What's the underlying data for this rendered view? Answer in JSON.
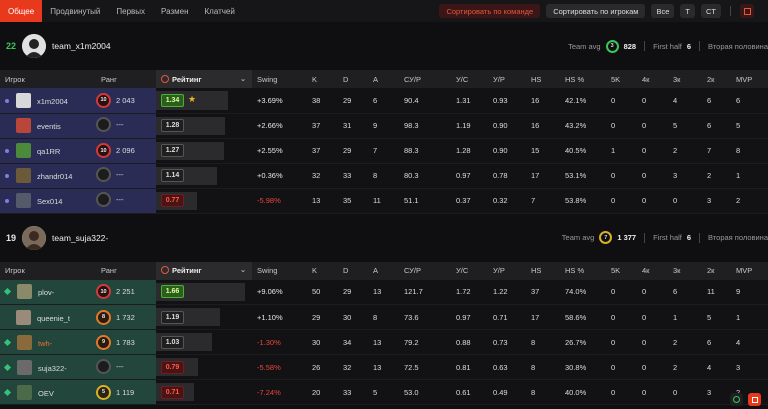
{
  "tabs": [
    "Общее",
    "Продвинутый",
    "Первых",
    "Размен",
    "Клатчей"
  ],
  "toolbar": {
    "sort_team": "Сортировать по команде",
    "sort_players": "Сортировать по игрокам",
    "all": "Все",
    "t": "T",
    "ct": "CT"
  },
  "columns": {
    "player": "Игрок",
    "rank": "Ранг",
    "rating": "Рейтинг",
    "swing": "Swing",
    "k": "K",
    "d": "D",
    "a": "A",
    "adr": "СУ/Р",
    "kpr": "У/С",
    "dpr": "У/Р",
    "hs": "HS",
    "hsp": "HS %",
    "k5": "5K",
    "k4": "4к",
    "k3": "3к",
    "k2": "2к",
    "mvp": "MVP"
  },
  "teams": [
    {
      "score": "22",
      "score_color": "#3bc45a",
      "name": "team_x1m2004",
      "avg_label": "Team avg",
      "avg_rank": "3",
      "avg_rank_color": "#3bc45a",
      "avg_value": "828",
      "half_label": "First half",
      "half_value": "6",
      "half2_label": "Вторая половина",
      "half2_value": "",
      "rating_label": "Рейтинг",
      "players": [
        {
          "name": "x1m2004",
          "marker": "dot",
          "avatar": "#d8d8d8",
          "rank": "10",
          "rank_style": "r",
          "rank_value": "2 043",
          "rating": "1.34",
          "rating_style": "green",
          "rating_fill": 0.75,
          "star": true,
          "swing": "+3.69%",
          "swing_neg": false,
          "k": "38",
          "d": "29",
          "a": "6",
          "adr": "90.4",
          "kpr": "1.31",
          "dpr": "0.93",
          "hs": "16",
          "hsp": "42.1%",
          "k5": "0",
          "k4": "0",
          "k3": "4",
          "k2": "6",
          "mvp": "6"
        },
        {
          "name": "eventis",
          "marker": "none",
          "avatar": "#b8473a",
          "rank": "",
          "rank_style": "g",
          "rank_value": "---",
          "rating": "1.28",
          "rating_style": "grey",
          "rating_fill": 0.72,
          "star": false,
          "swing": "+2.66%",
          "swing_neg": false,
          "k": "37",
          "d": "31",
          "a": "9",
          "adr": "98.3",
          "kpr": "1.19",
          "dpr": "0.90",
          "hs": "16",
          "hsp": "43.2%",
          "k5": "0",
          "k4": "0",
          "k3": "5",
          "k2": "6",
          "mvp": "5"
        },
        {
          "name": "qa1RR",
          "marker": "dot",
          "avatar": "#4a8a3a",
          "rank": "10",
          "rank_style": "r",
          "rank_value": "2 096",
          "rating": "1.27",
          "rating_style": "grey",
          "rating_fill": 0.71,
          "star": false,
          "swing": "+2.55%",
          "swing_neg": false,
          "k": "37",
          "d": "29",
          "a": "7",
          "adr": "88.3",
          "kpr": "1.28",
          "dpr": "0.90",
          "hs": "15",
          "hsp": "40.5%",
          "k5": "1",
          "k4": "0",
          "k3": "2",
          "k2": "7",
          "mvp": "8"
        },
        {
          "name": "zhandr014",
          "marker": "dot",
          "avatar": "#6a5a3a",
          "rank": "",
          "rank_style": "g",
          "rank_value": "---",
          "rating": "1.14",
          "rating_style": "grey",
          "rating_fill": 0.64,
          "star": false,
          "swing": "+0.36%",
          "swing_neg": false,
          "k": "32",
          "d": "33",
          "a": "8",
          "adr": "80.3",
          "kpr": "0.97",
          "dpr": "0.78",
          "hs": "17",
          "hsp": "53.1%",
          "k5": "0",
          "k4": "0",
          "k3": "3",
          "k2": "2",
          "mvp": "1"
        },
        {
          "name": "Sex014",
          "marker": "dot",
          "avatar": "#555a6a",
          "rank": "",
          "rank_style": "g",
          "rank_value": "---",
          "rating": "0.77",
          "rating_style": "red",
          "rating_fill": 0.43,
          "star": false,
          "swing": "-5.98%",
          "swing_neg": true,
          "k": "13",
          "d": "35",
          "a": "11",
          "adr": "51.1",
          "kpr": "0.37",
          "dpr": "0.32",
          "hs": "7",
          "hsp": "53.8%",
          "k5": "0",
          "k4": "0",
          "k3": "0",
          "k2": "3",
          "mvp": "2"
        }
      ]
    },
    {
      "score": "19",
      "score_color": "#e8e8e8",
      "name": "team_suja322-",
      "avg_label": "Team avg",
      "avg_rank": "7",
      "avg_rank_color": "#d9b02a",
      "avg_value": "1 377",
      "half_label": "First half",
      "half_value": "6",
      "half2_label": "Вторая половина",
      "half2_value": "",
      "rating_label": "Рейтинг",
      "players": [
        {
          "name": "plov-",
          "marker": "diamond",
          "avatar": "#8a8a6a",
          "rank": "10",
          "rank_style": "r",
          "rank_value": "2 251",
          "rating": "1.66",
          "rating_style": "green",
          "rating_fill": 0.93,
          "star": false,
          "swing": "+9.06%",
          "swing_neg": false,
          "k": "50",
          "d": "29",
          "a": "13",
          "adr": "121.7",
          "kpr": "1.72",
          "dpr": "1.22",
          "hs": "37",
          "hsp": "74.0%",
          "k5": "0",
          "k4": "0",
          "k3": "6",
          "k2": "11",
          "mvp": "9"
        },
        {
          "name": "queenie_t",
          "marker": "none",
          "avatar": "#9a8a7a",
          "rank": "8",
          "rank_style": "o",
          "rank_value": "1 732",
          "rating": "1.19",
          "rating_style": "grey",
          "rating_fill": 0.67,
          "star": false,
          "swing": "+1.10%",
          "swing_neg": false,
          "k": "29",
          "d": "30",
          "a": "8",
          "adr": "73.6",
          "kpr": "0.97",
          "dpr": "0.71",
          "hs": "17",
          "hsp": "58.6%",
          "k5": "0",
          "k4": "0",
          "k3": "1",
          "k2": "5",
          "mvp": "1"
        },
        {
          "name": "twh-",
          "marker": "diamond",
          "name_color": "#f07030",
          "avatar": "#8a6a3a",
          "rank": "9",
          "rank_style": "o",
          "rank_value": "1 783",
          "rating": "1.03",
          "rating_style": "grey",
          "rating_fill": 0.58,
          "star": false,
          "swing": "-1.30%",
          "swing_neg": true,
          "k": "30",
          "d": "34",
          "a": "13",
          "adr": "79.2",
          "kpr": "0.88",
          "dpr": "0.73",
          "hs": "8",
          "hsp": "26.7%",
          "k5": "0",
          "k4": "0",
          "k3": "2",
          "k2": "6",
          "mvp": "4"
        },
        {
          "name": "suja322-",
          "marker": "diamond",
          "avatar": "#6a6a6a",
          "rank": "",
          "rank_style": "g",
          "rank_value": "---",
          "rating": "0.79",
          "rating_style": "red",
          "rating_fill": 0.44,
          "star": false,
          "swing": "-5.58%",
          "swing_neg": true,
          "k": "26",
          "d": "32",
          "a": "13",
          "adr": "72.5",
          "kpr": "0.81",
          "dpr": "0.63",
          "hs": "8",
          "hsp": "30.8%",
          "k5": "0",
          "k4": "0",
          "k3": "2",
          "k2": "4",
          "mvp": "3"
        },
        {
          "name": "OEV",
          "marker": "diamond",
          "avatar": "#4a6a4a",
          "rank": "5",
          "rank_style": "y",
          "rank_value": "1 119",
          "rating": "0.71",
          "rating_style": "red",
          "rating_fill": 0.4,
          "star": false,
          "swing": "-7.24%",
          "swing_neg": true,
          "k": "20",
          "d": "33",
          "a": "5",
          "adr": "53.0",
          "kpr": "0.61",
          "dpr": "0.49",
          "hs": "8",
          "hsp": "40.0%",
          "k5": "0",
          "k4": "0",
          "k3": "0",
          "k2": "3",
          "mvp": "2"
        }
      ]
    }
  ]
}
